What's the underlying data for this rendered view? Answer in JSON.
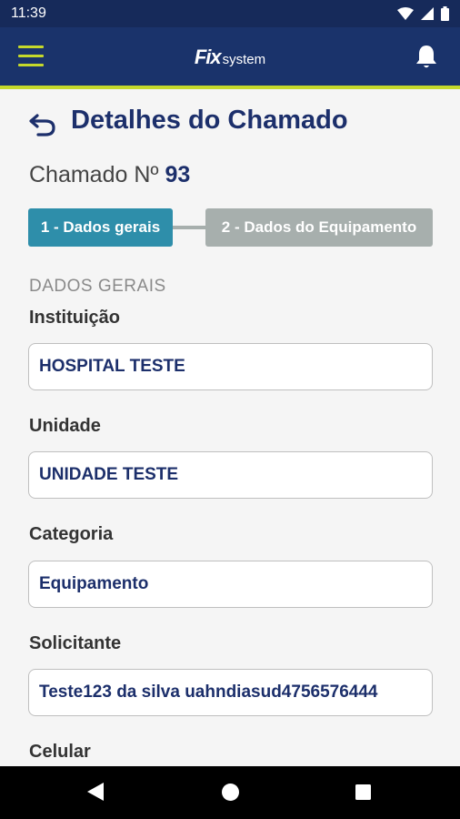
{
  "status_bar": {
    "time": "11:39"
  },
  "app_bar": {
    "logo_brand": "Fix",
    "logo_sub": "system"
  },
  "page": {
    "title": "Detalhes do Chamado",
    "ticket_label": "Chamado Nº",
    "ticket_number": "93"
  },
  "steps": [
    {
      "label": "1 - Dados gerais",
      "active": true
    },
    {
      "label": "2 - Dados do Equipamento",
      "active": false
    }
  ],
  "section": {
    "title": "DADOS GERAIS"
  },
  "fields": [
    {
      "label": "Instituição",
      "value": "HOSPITAL TESTE"
    },
    {
      "label": "Unidade",
      "value": "UNIDADE TESTE"
    },
    {
      "label": "Categoria",
      "value": "Equipamento"
    },
    {
      "label": "Solicitante",
      "value": "Teste123 da silva uahndiasud4756576444"
    },
    {
      "label": "Celular",
      "value": ""
    }
  ],
  "colors": {
    "app_bar": "#1a336b",
    "accent": "#c5d92b",
    "step_active": "#2e8eaa",
    "step_inactive": "#a7afad",
    "title": "#1c2f6b"
  }
}
